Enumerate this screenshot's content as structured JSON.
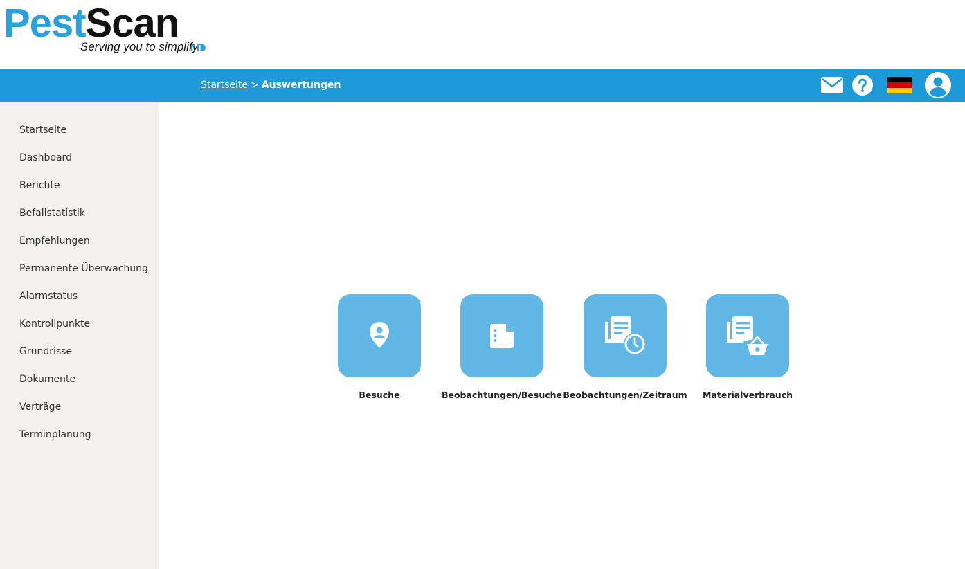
{
  "brand": {
    "name_part1": "Pest",
    "name_part2": "Scan",
    "tagline": "Serving you to simplify",
    "color_primary": "#2aa0dc",
    "color_dark": "#111111"
  },
  "topbar": {
    "background": "#1f9ad8",
    "breadcrumb": {
      "home_label": "Startseite",
      "separator": ">",
      "current_label": "Auswertungen"
    },
    "icons": {
      "mail": "mail-icon",
      "help": "help-icon",
      "language": "german-flag-icon",
      "account": "user-account-icon"
    }
  },
  "sidebar": {
    "items": [
      {
        "label": "Startseite"
      },
      {
        "label": "Dashboard"
      },
      {
        "label": "Berichte"
      },
      {
        "label": "Befallstatistik"
      },
      {
        "label": "Empfehlungen"
      },
      {
        "label": "Permanente Überwachung"
      },
      {
        "label": "Alarmstatus"
      },
      {
        "label": "Kontrollpunkte"
      },
      {
        "label": "Grundrisse"
      },
      {
        "label": "Dokumente"
      },
      {
        "label": "Verträge"
      },
      {
        "label": "Terminplanung"
      }
    ]
  },
  "tiles": [
    {
      "label": "Besuche",
      "icon": "location-pin-icon"
    },
    {
      "label": "Beobachtungen/Besuche",
      "icon": "document-icon"
    },
    {
      "label": "Beobachtungen/Zeitraum",
      "icon": "documents-clock-icon"
    },
    {
      "label": "Materialverbrauch",
      "icon": "documents-basket-icon"
    }
  ],
  "colors": {
    "tile_background": "#61b8e6",
    "sidebar_background": "#f3f2f0"
  }
}
